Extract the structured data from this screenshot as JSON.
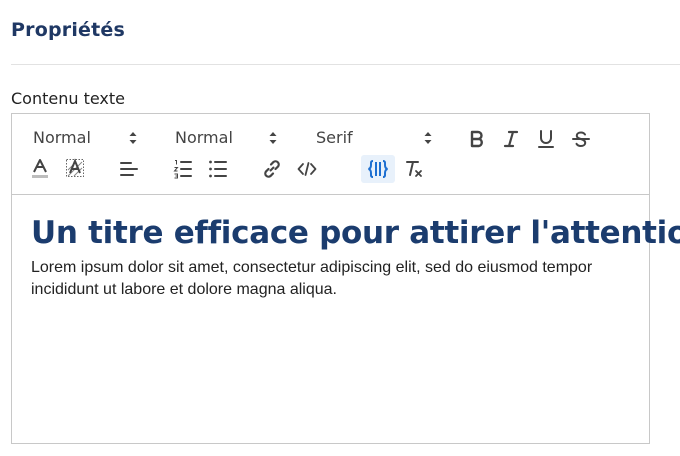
{
  "panel": {
    "title": "Propriétés"
  },
  "field": {
    "label": "Contenu texte"
  },
  "toolbar": {
    "heading_select": "Normal",
    "size_select": "Normal",
    "font_select": "Serif"
  },
  "content": {
    "heading": "Un titre efficace pour attirer l'attention",
    "paragraph": "Lorem ipsum dolor sit amet, consectetur adipiscing elit, sed do eiusmod tempor incididunt ut labore et dolore magna aliqua."
  },
  "colors": {
    "title": "#1f3864",
    "heading": "#1b3c6e",
    "active_icon": "#1c6fd1"
  }
}
